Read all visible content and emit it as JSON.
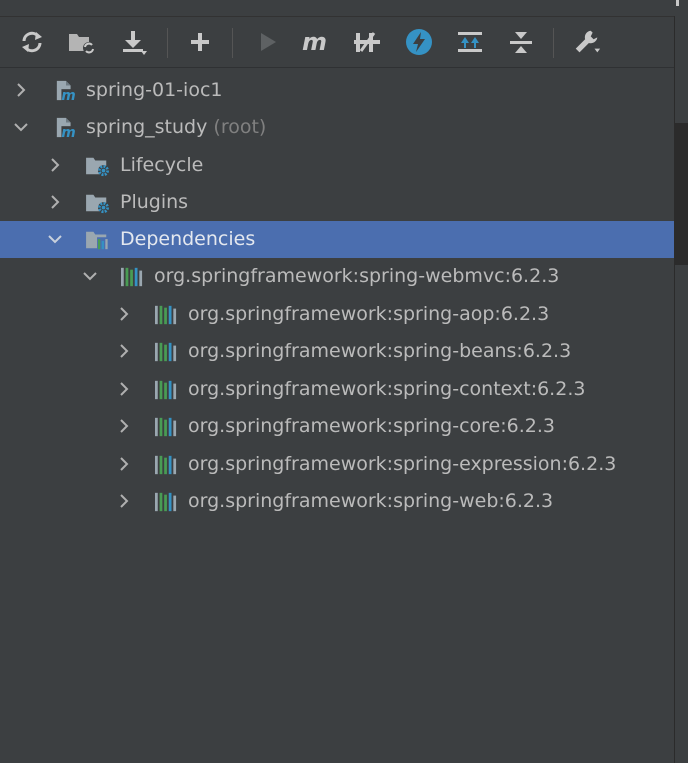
{
  "toolbar": {
    "buttons": [
      "reload-icon",
      "folder-sync-icon",
      "download-icon",
      "add-icon",
      "run-icon",
      "maven-icon",
      "skip-tests-icon",
      "lightning-icon",
      "collapse-all-icon",
      "expand-all-icon",
      "wrench-icon"
    ]
  },
  "tree": {
    "items": [
      {
        "label": "spring-01-ioc1",
        "expanded": false
      },
      {
        "label": "spring_study",
        "suffix": "(root)",
        "expanded": true
      },
      {
        "label": "Lifecycle",
        "expanded": false
      },
      {
        "label": "Plugins",
        "expanded": false
      },
      {
        "label": "Dependencies",
        "expanded": true,
        "selected": true
      },
      {
        "label": "org.springframework:spring-webmvc:6.2.3",
        "expanded": true
      },
      {
        "label": "org.springframework:spring-aop:6.2.3",
        "expanded": false
      },
      {
        "label": "org.springframework:spring-beans:6.2.3",
        "expanded": false
      },
      {
        "label": "org.springframework:spring-context:6.2.3",
        "expanded": false
      },
      {
        "label": "org.springframework:spring-core:6.2.3",
        "expanded": false
      },
      {
        "label": "org.springframework:spring-expression:6.2.3",
        "expanded": false
      },
      {
        "label": "org.springframework:spring-web:6.2.3",
        "expanded": false
      }
    ]
  },
  "colors": {
    "background": "#3c3f41",
    "selection": "#4b6eaf",
    "text": "#bbbbbb",
    "muted_text": "#808080",
    "icon_blue": "#3592c4",
    "icon_green": "#499c54"
  }
}
